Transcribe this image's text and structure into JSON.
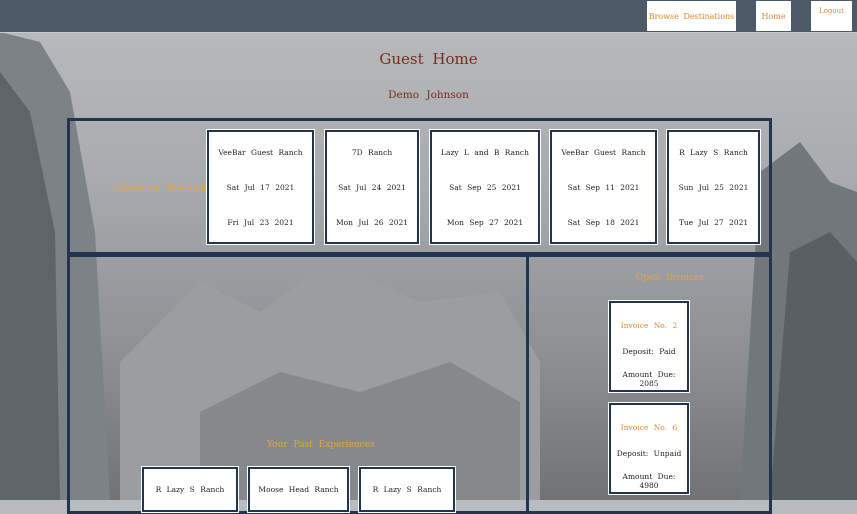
{
  "nav": {
    "browse_label": "Browse Destinations",
    "home_label": "Home",
    "logout_label": "Logout"
  },
  "page": {
    "title": "Guest Home",
    "guest_name": "Demo Johnson"
  },
  "upcoming": {
    "label": "Upcoming Bookings",
    "bookings": [
      {
        "ranch": "VeeBar Guest Ranch",
        "start": "Sat Jul 17 2021",
        "end": "Fri Jul 23 2021"
      },
      {
        "ranch": "7D Ranch",
        "start": "Sat Jul 24 2021",
        "end": "Mon Jul 26 2021"
      },
      {
        "ranch": "Lazy L and B Ranch",
        "start": "Sat Sep 25 2021",
        "end": "Mon Sep 27 2021"
      },
      {
        "ranch": "VeeBar Guest Ranch",
        "start": "Sat Sep 11 2021",
        "end": "Sat Sep 18 2021"
      },
      {
        "ranch": "R Lazy S Ranch",
        "start": "Sun Jul 25 2021",
        "end": "Tue Jul 27 2021"
      }
    ]
  },
  "past": {
    "label": "Your Past Experiences",
    "items": [
      {
        "ranch": "R Lazy S Ranch"
      },
      {
        "ranch": "Moose Head Ranch"
      },
      {
        "ranch": "R Lazy S Ranch"
      }
    ]
  },
  "invoices": {
    "label": "Open Invoices",
    "items": [
      {
        "number": "Invoice No. 2",
        "deposit": "Deposit: Paid",
        "amount": "Amount Due: 2085"
      },
      {
        "number": "Invoice No. 6",
        "deposit": "Deposit: Unpaid",
        "amount": "Amount Due: 4980"
      }
    ]
  },
  "colors": {
    "navbar": "#4d5966",
    "accent_orange": "#e08a2c",
    "title_brown": "#7a2e18",
    "frame_navy": "#23344f"
  }
}
